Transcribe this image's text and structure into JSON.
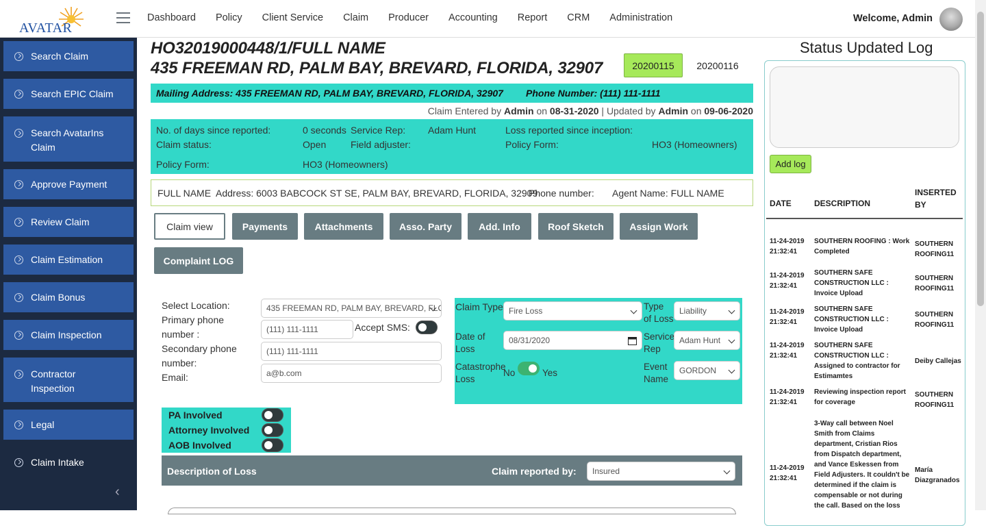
{
  "header": {
    "logo_text": "AVATAR",
    "nav": [
      "Dashboard",
      "Policy",
      "Client Service",
      "Claim",
      "Producer",
      "Accounting",
      "Report",
      "CRM",
      "Administration"
    ],
    "welcome": "Welcome, Admin"
  },
  "sidebar": {
    "items": [
      "Search Claim",
      "Search EPIC Claim",
      "Search AvatarIns Claim",
      "Approve Payment",
      "Review Claim",
      "Claim Estimation",
      "Claim Bonus",
      "Claim Inspection",
      "Contractor Inspection",
      "Legal",
      "Claim Intake"
    ],
    "collapse": "‹"
  },
  "claim": {
    "title_line1": "HO32019000448/1/FULL NAME",
    "title_line2": "435 FREEMAN RD, PALM BAY, BREVARD, FLORIDA, 32907",
    "date_active": "20200115",
    "date_other": "20200116",
    "mailing": "Mailing Address: 435 FREEMAN RD, PALM BAY, BREVARD, FLORIDA, 32907",
    "phone": "Phone Number: (111) 111-1111",
    "entered_prefix": "Claim Entered by",
    "entered_by": "Admin",
    "on1": "on",
    "entered_date": "08-31-2020",
    "updated_prefix": "| Updated by",
    "updated_by": "Admin",
    "on2": "on",
    "updated_date": "09-06-2020"
  },
  "info": {
    "days_label": "No. of days since reported:",
    "days_value": "0 seconds",
    "service_rep_label": "Service Rep:",
    "service_rep_value": "Adam Hunt",
    "loss_label": "Loss reported since inception:",
    "status_label": "Claim status:",
    "status_value": "Open",
    "field_adj_label": "Field adjuster:",
    "policy_form_label": "Policy Form:",
    "policy_form_value": "HO3 (Homeowners)",
    "policy_form_label2": "Policy Form:",
    "policy_form_value2": "HO3 (Homeowners)"
  },
  "party": {
    "name": "FULL NAME",
    "address": "Address: 6003 BABCOCK ST SE, PALM BAY, BREVARD, FLORIDA, 32909",
    "phone": "Phone number:",
    "agent": "Agent Name: FULL NAME"
  },
  "tabs": [
    "Claim view",
    "Payments",
    "Attachments",
    "Asso. Party",
    "Add. Info",
    "Roof Sketch",
    "Assign Work",
    "Complaint LOG"
  ],
  "form": {
    "select_location_label": "Select Location:",
    "select_location_value": "435 FREEMAN RD, PALM BAY, BREVARD, FLO",
    "primary_phone_label_1": "Primary phone",
    "primary_phone_label_2": "number :",
    "primary_phone_placeholder": "(111) 111-1111",
    "accept_sms": "Accept SMS:",
    "secondary_phone_label_1": "Secondary phone",
    "secondary_phone_label_2": "number:",
    "secondary_phone_placeholder": "(111) 111-1111",
    "email_label": "Email:",
    "email_placeholder": "a@b.com"
  },
  "claim_box": {
    "claim_type_label": "Claim Type",
    "claim_type_value": "Fire Loss",
    "type_of_loss_label_1": "Type",
    "type_of_loss_label_2": "of Loss",
    "type_of_loss_value": "Liability",
    "date_of_loss_label_1": "Date of",
    "date_of_loss_label_2": "Loss",
    "date_of_loss_value": "08/31/2020",
    "service_rep_label_1": "Service",
    "service_rep_label_2": "Rep",
    "service_rep_value": "Adam Hunt",
    "catastrophe_label_1": "Catastrophe",
    "catastrophe_label_2": "Loss",
    "no": "No",
    "yes": "Yes",
    "event_label_1": "Event",
    "event_label_2": "Name",
    "event_value": "GORDON"
  },
  "involved": {
    "pa": "PA Involved",
    "attorney": "Attorney Involved",
    "aob": "AOB Involved"
  },
  "desc_bar": {
    "title": "Description of Loss",
    "reported_by_label": "Claim reported by:",
    "reported_by_value": "Insured"
  },
  "log": {
    "title": "Status Updated Log",
    "add_button": "Add log",
    "col_date": "DATE",
    "col_desc": "DESCRIPTION",
    "col_by_1": "INSERTED",
    "col_by_2": "BY",
    "rows": [
      {
        "date": "11-24-2019 21:32:41",
        "desc": "SOUTHERN ROOFING : Work Completed",
        "by": "SOUTHERN ROOFING11"
      },
      {
        "date": "11-24-2019 21:32:41",
        "desc": "SOUTHERN SAFE CONSTRUCTION LLC : Invoice Upload",
        "by": "SOUTHERN ROOFING11"
      },
      {
        "date": "11-24-2019 21:32:41",
        "desc": "SOUTHERN SAFE CONSTRUCTION LLC : Invoice Upload",
        "by": "SOUTHERN ROOFING11"
      },
      {
        "date": "11-24-2019 21:32:41",
        "desc": "SOUTHERN SAFE CONSTRUCTION LLC : Assigned to contractor for Estimamtes",
        "by": "Deiby Callejas"
      },
      {
        "date": "11-24-2019 21:32:41",
        "desc": "Reviewing inspection report for coverage",
        "by": "SOUTHERN ROOFING11"
      },
      {
        "date": "11-24-2019 21:32:41",
        "desc": "3-Way call between Noel Smith from Claims department, Cristian Rios from Dispatch department, and Vance Eskessen from Field Adjusters. It couldn't be determined if the claim is compensable or not during the call. Based on the loss",
        "by": "María Diazgranados"
      }
    ]
  },
  "colors": {
    "teal": "#32d8c8",
    "nav_blue": "#2e5aa2",
    "sidebar_bg": "#1c2a41",
    "tab_gray": "#687c82",
    "green": "#a6e95a"
  }
}
